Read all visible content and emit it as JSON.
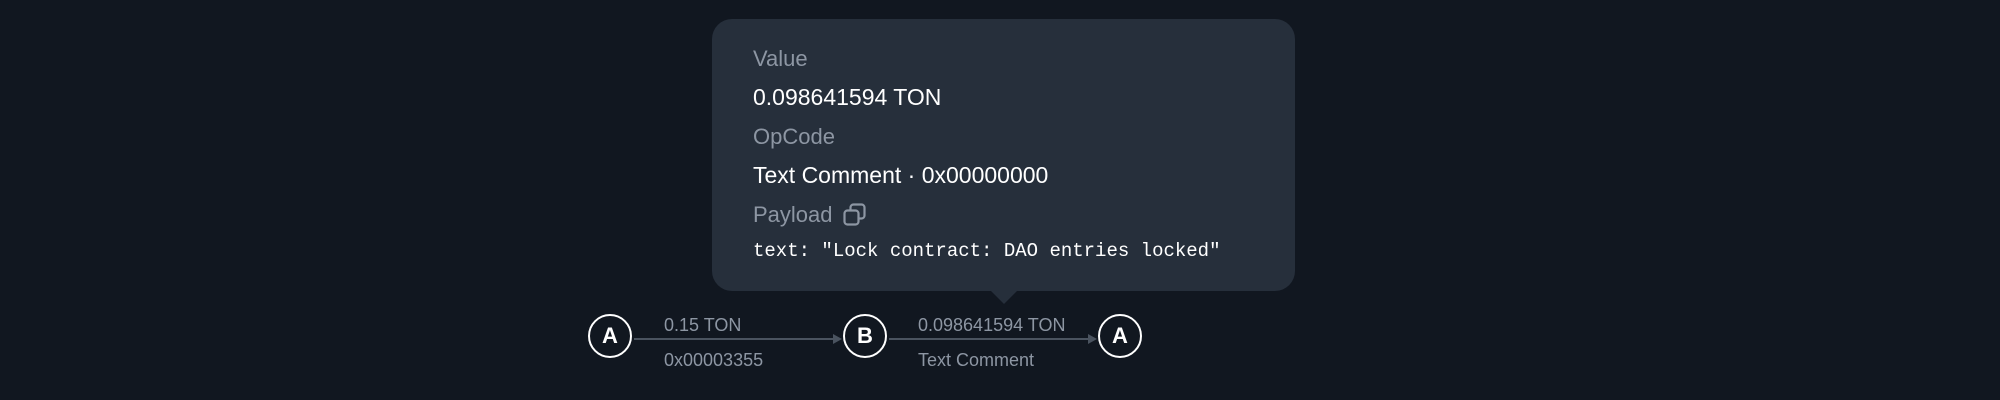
{
  "tooltip": {
    "value_label": "Value",
    "value": "0.098641594 TON",
    "opcode_label": "OpCode",
    "opcode": "Text Comment · 0x00000000",
    "payload_label": "Payload",
    "payload_icon": "copy-icon",
    "payload": "text: \"Lock contract: DAO entries locked\""
  },
  "flow": {
    "nodes": [
      {
        "label": "A"
      },
      {
        "label": "B"
      },
      {
        "label": "A"
      }
    ],
    "edges": [
      {
        "amount": "0.15 TON",
        "opcode": "0x00003355"
      },
      {
        "amount": "0.098641594 TON",
        "opcode": "Text Comment"
      }
    ]
  },
  "colors": {
    "background": "#111720",
    "tooltip_background": "#262f3b",
    "muted_text": "#8d96a3",
    "primary_text": "#ffffff",
    "edge_line": "#4a535f"
  }
}
